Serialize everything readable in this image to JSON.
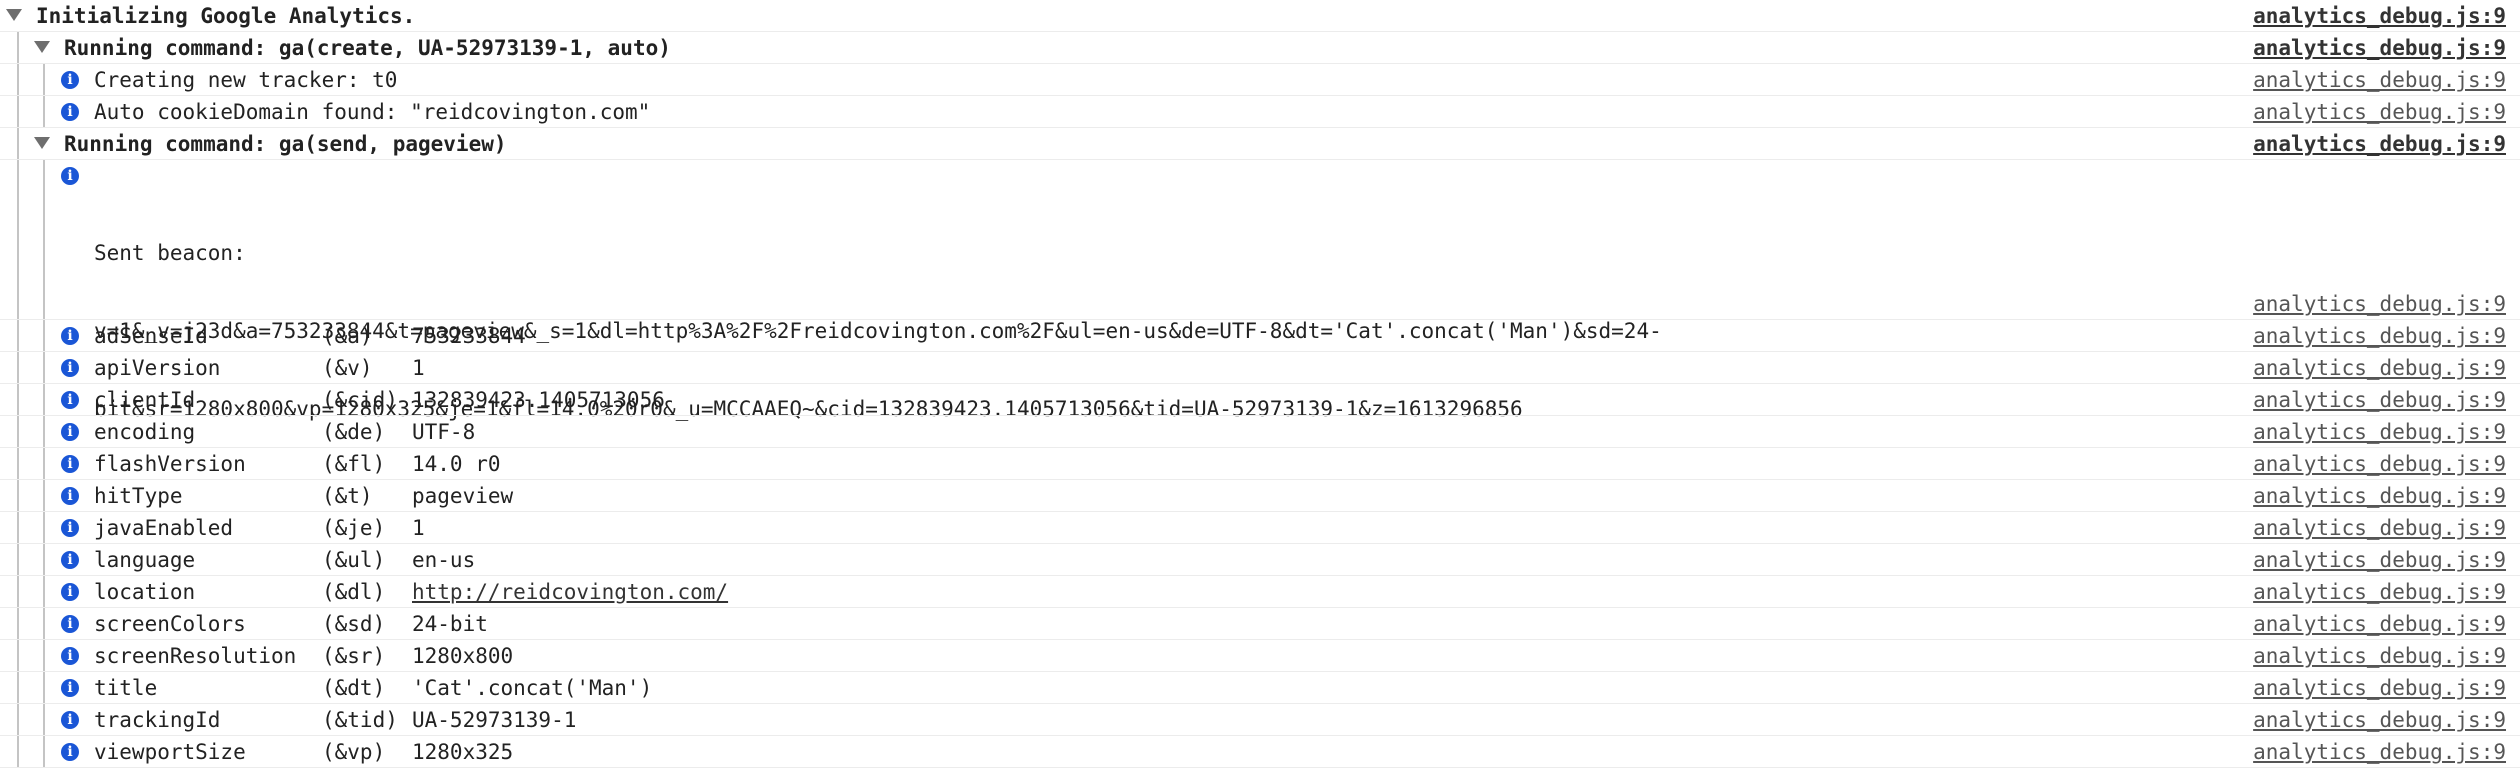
{
  "groups": {
    "init": {
      "title": "Initializing Google Analytics.",
      "source": "analytics_debug.js:9"
    },
    "create": {
      "title": "Running command: ga(create, UA-52973139-1, auto)",
      "source": "analytics_debug.js:9"
    },
    "send": {
      "title": "Running command: ga(send, pageview)",
      "source": "analytics_debug.js:9"
    }
  },
  "create_messages": [
    {
      "text": "Creating new tracker: t0",
      "source": "analytics_debug.js:9"
    },
    {
      "text": "Auto cookieDomain found: \"reidcovington.com\"",
      "source": "analytics_debug.js:9"
    }
  ],
  "beacon": {
    "label": "Sent beacon:",
    "line1": "v=1&_v=j23d&a=753233844&t=pageview&_s=1&dl=http%3A%2F%2Freidcovington.com%2F&ul=en-us&de=UTF-8&dt='Cat'.concat('Man')&sd=24-",
    "line2": "bit&sr=1280x800&vp=1280x325&je=1&fl=14.0%20r0&_u=MCCAAEQ~&cid=132839423.1405713056&tid=UA-52973139-1&z=1613296856",
    "source": "analytics_debug.js:9"
  },
  "params": [
    {
      "name": "adSenseId",
      "key": "(&a)",
      "value": "753233844",
      "source": "analytics_debug.js:9"
    },
    {
      "name": "apiVersion",
      "key": "(&v)",
      "value": "1",
      "source": "analytics_debug.js:9"
    },
    {
      "name": "clientId",
      "key": "(&cid)",
      "value": "132839423.1405713056",
      "source": "analytics_debug.js:9"
    },
    {
      "name": "encoding",
      "key": "(&de)",
      "value": "UTF-8",
      "source": "analytics_debug.js:9"
    },
    {
      "name": "flashVersion",
      "key": "(&fl)",
      "value": "14.0 r0",
      "source": "analytics_debug.js:9"
    },
    {
      "name": "hitType",
      "key": "(&t)",
      "value": "pageview",
      "source": "analytics_debug.js:9"
    },
    {
      "name": "javaEnabled",
      "key": "(&je)",
      "value": "1",
      "source": "analytics_debug.js:9"
    },
    {
      "name": "language",
      "key": "(&ul)",
      "value": "en-us",
      "source": "analytics_debug.js:9"
    },
    {
      "name": "location",
      "key": "(&dl)",
      "value": "http://reidcovington.com/",
      "source": "analytics_debug.js:9",
      "link": true
    },
    {
      "name": "screenColors",
      "key": "(&sd)",
      "value": "24-bit",
      "source": "analytics_debug.js:9"
    },
    {
      "name": "screenResolution",
      "key": "(&sr)",
      "value": "1280x800",
      "source": "analytics_debug.js:9"
    },
    {
      "name": "title",
      "key": "(&dt)",
      "value": "'Cat'.concat('Man')",
      "source": "analytics_debug.js:9"
    },
    {
      "name": "trackingId",
      "key": "(&tid)",
      "value": "UA-52973139-1",
      "source": "analytics_debug.js:9"
    },
    {
      "name": "viewportSize",
      "key": "(&vp)",
      "value": "1280x325",
      "source": "analytics_debug.js:9"
    }
  ],
  "icons": {
    "expand": "triangle-down-icon",
    "info": "info-icon"
  },
  "colors": {
    "info_icon": "#1a56d6",
    "guide": "#c4c4c4"
  }
}
